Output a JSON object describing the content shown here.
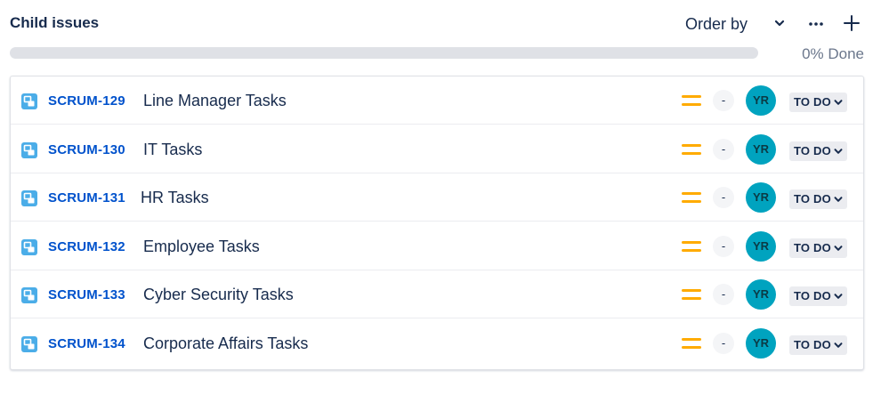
{
  "header": {
    "title": "Child issues",
    "order_by_label": "Order by",
    "chevron_icon": "chevron-down-icon",
    "more_icon": "more-icon",
    "add_icon": "plus-icon"
  },
  "progress": {
    "percent_done": 0,
    "label": "0% Done"
  },
  "issues": [
    {
      "key": "SCRUM-129",
      "summary": "Line Manager Tasks",
      "priority": "medium",
      "estimate": "-",
      "assignee_initials": "YR",
      "status": "TO DO"
    },
    {
      "key": "SCRUM-130",
      "summary": "IT Tasks",
      "priority": "medium",
      "estimate": "-",
      "assignee_initials": "YR",
      "status": "TO DO"
    },
    {
      "key": "SCRUM-131",
      "summary": "HR Tasks",
      "priority": "medium",
      "estimate": "-",
      "assignee_initials": "YR",
      "status": "TO DO"
    },
    {
      "key": "SCRUM-132",
      "summary": "Employee Tasks",
      "priority": "medium",
      "estimate": "-",
      "assignee_initials": "YR",
      "status": "TO DO"
    },
    {
      "key": "SCRUM-133",
      "summary": "Cyber Security Tasks",
      "priority": "medium",
      "estimate": "-",
      "assignee_initials": "YR",
      "status": "TO DO"
    },
    {
      "key": "SCRUM-134",
      "summary": "Corporate Affairs Tasks",
      "priority": "medium",
      "estimate": "-",
      "assignee_initials": "YR",
      "status": "TO DO"
    }
  ],
  "colors": {
    "link": "#0052cc",
    "priority_medium": "#ffab00",
    "avatar": "#00a3bf",
    "subtask_icon": "#4bade8",
    "progress_done": "#36b37e"
  }
}
